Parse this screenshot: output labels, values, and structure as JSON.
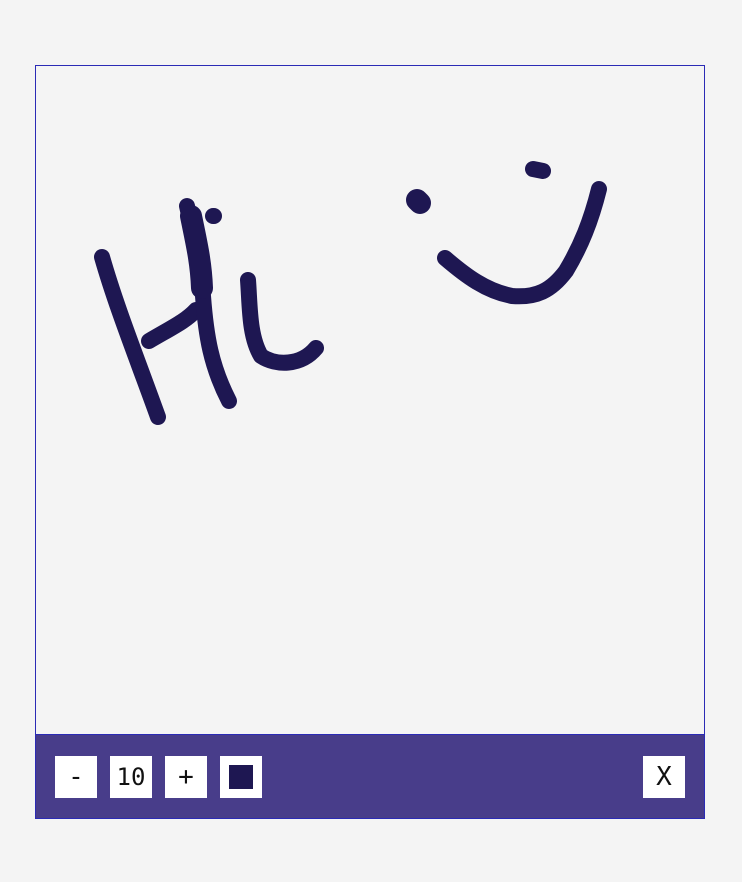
{
  "toolbar": {
    "minus_label": "-",
    "brush_size": "10",
    "plus_label": "+",
    "close_label": "X",
    "brush_color": "#1e1752"
  },
  "colors": {
    "background": "#f4f4f4",
    "toolbar_bg": "#483d8a",
    "border": "#2b2bb5",
    "ink": "#1e1752"
  }
}
